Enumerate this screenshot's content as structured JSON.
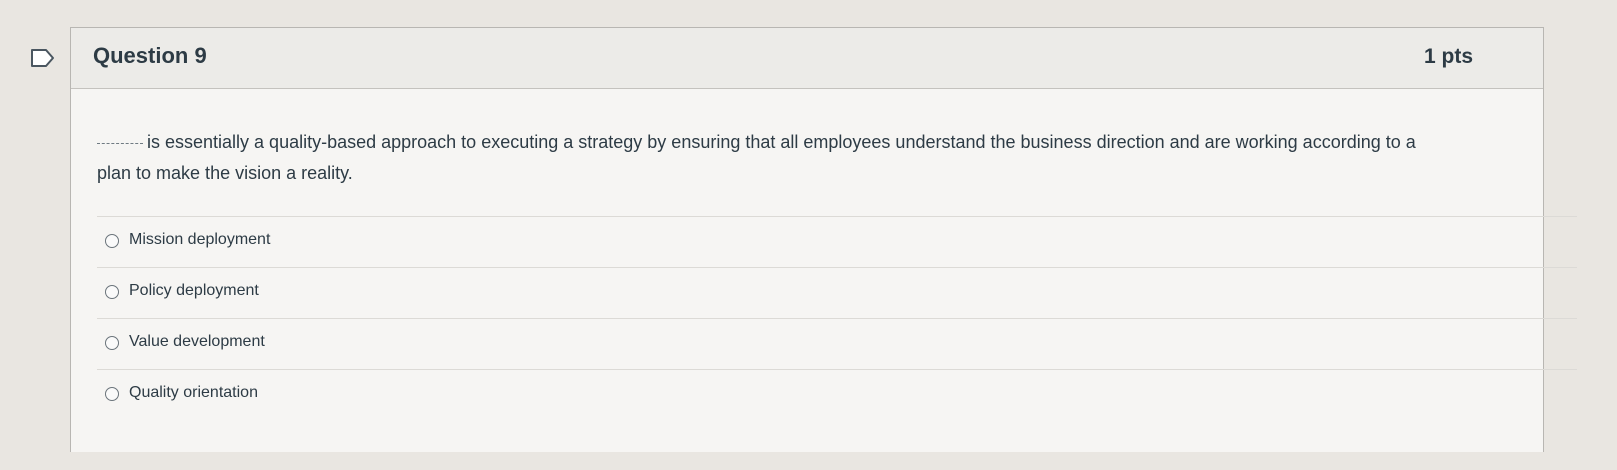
{
  "question": {
    "title": "Question 9",
    "points": "1 pts",
    "text": "is essentially a quality-based approach to executing a strategy by ensuring that all employees understand the business direction and are working according to a plan to make the vision a reality.",
    "flag_icon": "bookmark-flag-icon"
  },
  "answers": [
    {
      "label": "Mission deployment",
      "selected": false
    },
    {
      "label": "Policy deployment",
      "selected": false
    },
    {
      "label": "Value development",
      "selected": false
    },
    {
      "label": "Quality orientation",
      "selected": false
    }
  ]
}
